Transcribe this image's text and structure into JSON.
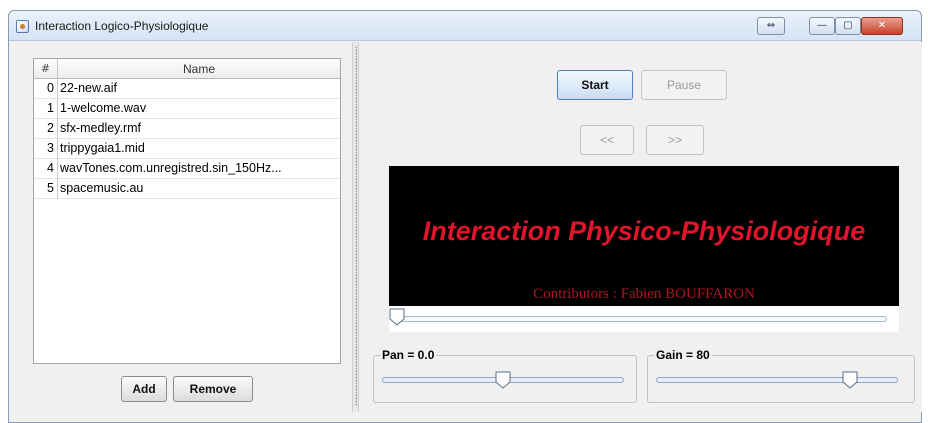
{
  "window": {
    "title": "Interaction Logico-Physiologique",
    "controls": {
      "restore": "⇔",
      "minimize": "—",
      "maximize": "▢",
      "close": "✕"
    }
  },
  "playlist": {
    "headers": {
      "index": "#",
      "name": "Name"
    },
    "rows": [
      {
        "index": "0",
        "name": "22-new.aif"
      },
      {
        "index": "1",
        "name": "1-welcome.wav"
      },
      {
        "index": "2",
        "name": "sfx-medley.rmf"
      },
      {
        "index": "3",
        "name": "trippygaia1.mid"
      },
      {
        "index": "4",
        "name": "wavTones.com.unregistred.sin_150Hz..."
      },
      {
        "index": "5",
        "name": "spacemusic.au"
      }
    ],
    "add_label": "Add",
    "remove_label": "Remove"
  },
  "transport": {
    "start_label": "Start",
    "pause_label": "Pause",
    "prev_label": "<<",
    "next_label": ">>"
  },
  "display": {
    "title": "Interaction Physico-Physiologique",
    "contributors": "Contributors : Fabien BOUFFARON",
    "title_color": "#e0142a",
    "contributors_color": "#b01422",
    "background": "#000000"
  },
  "position": {
    "fraction": 0.0
  },
  "pan": {
    "label": "Pan = 0.0",
    "fraction": 0.5
  },
  "gain": {
    "label": "Gain = 80",
    "fraction": 0.8
  }
}
